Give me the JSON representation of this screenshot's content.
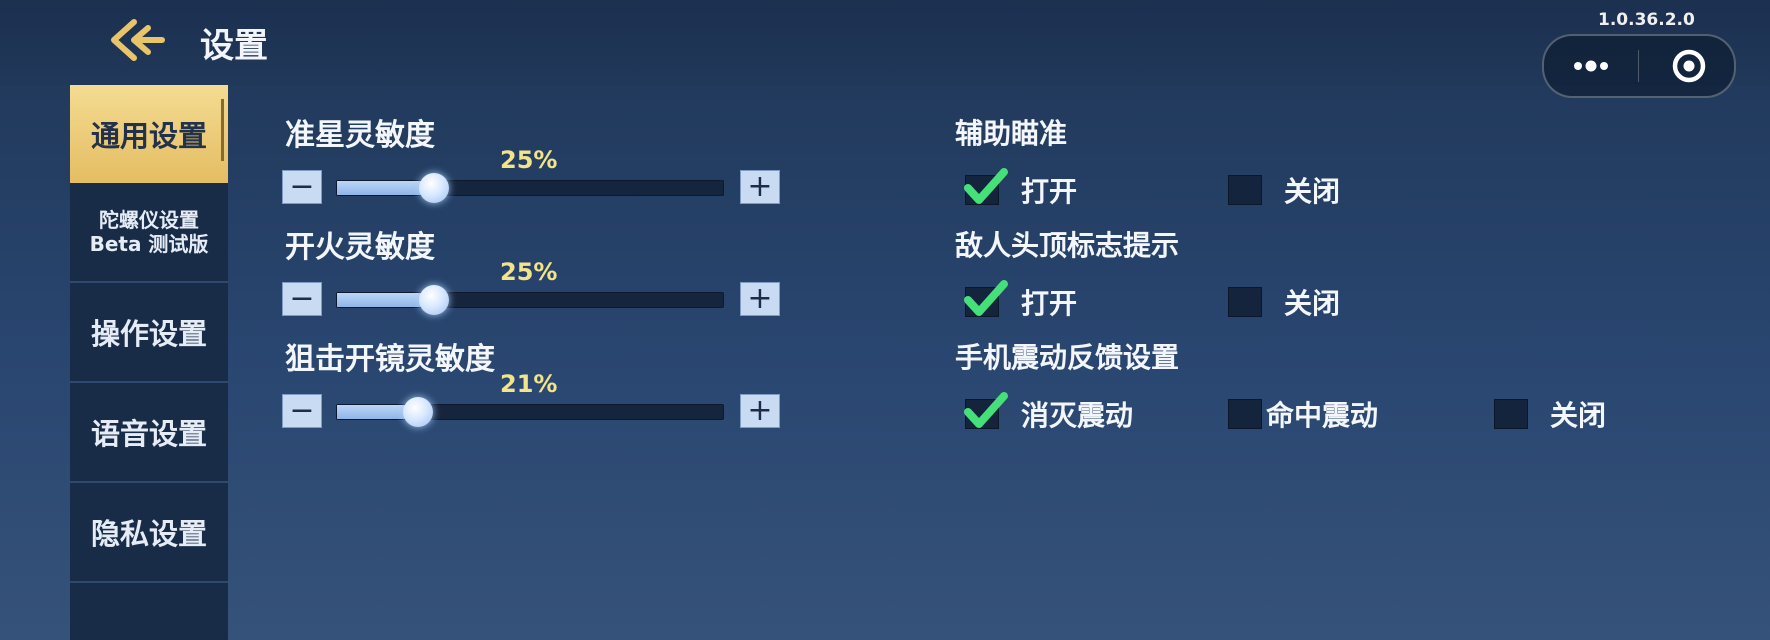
{
  "header": {
    "title": "设置",
    "version": "1.0.36.2.0"
  },
  "sidebar": {
    "items": [
      {
        "label": "通用设置",
        "active": true
      },
      {
        "label": "陀螺仪设置",
        "label2": "Beta 测试版",
        "active": false
      },
      {
        "label": "操作设置",
        "active": false
      },
      {
        "label": "语音设置",
        "active": false
      },
      {
        "label": "隐私设置",
        "active": false
      }
    ]
  },
  "sliders": [
    {
      "label": "准星灵敏度",
      "percent_label": "25%",
      "value": 25
    },
    {
      "label": "开火灵敏度",
      "percent_label": "25%",
      "value": 25
    },
    {
      "label": "狙击开镜灵敏度",
      "percent_label": "21%",
      "value": 21
    }
  ],
  "options": [
    {
      "heading": "辅助瞄准",
      "choices": [
        {
          "label": "打开",
          "checked": true
        },
        {
          "label": "关闭",
          "checked": false
        }
      ]
    },
    {
      "heading": "敌人头顶标志提示",
      "choices": [
        {
          "label": "打开",
          "checked": true
        },
        {
          "label": "关闭",
          "checked": false
        }
      ]
    },
    {
      "heading": "手机震动反馈设置",
      "choices": [
        {
          "label": "消灭震动",
          "checked": true
        },
        {
          "label": "命中震动",
          "checked": false
        },
        {
          "label": "关闭",
          "checked": false
        }
      ]
    }
  ],
  "colors": {
    "accent": "#e8c56a",
    "check": "#46e07a",
    "percent": "#f2e48a"
  },
  "icons": {
    "back": "back-arrow-icon",
    "more": "more-dots-icon",
    "close": "capsule-close-icon",
    "check": "checkmark-icon"
  }
}
